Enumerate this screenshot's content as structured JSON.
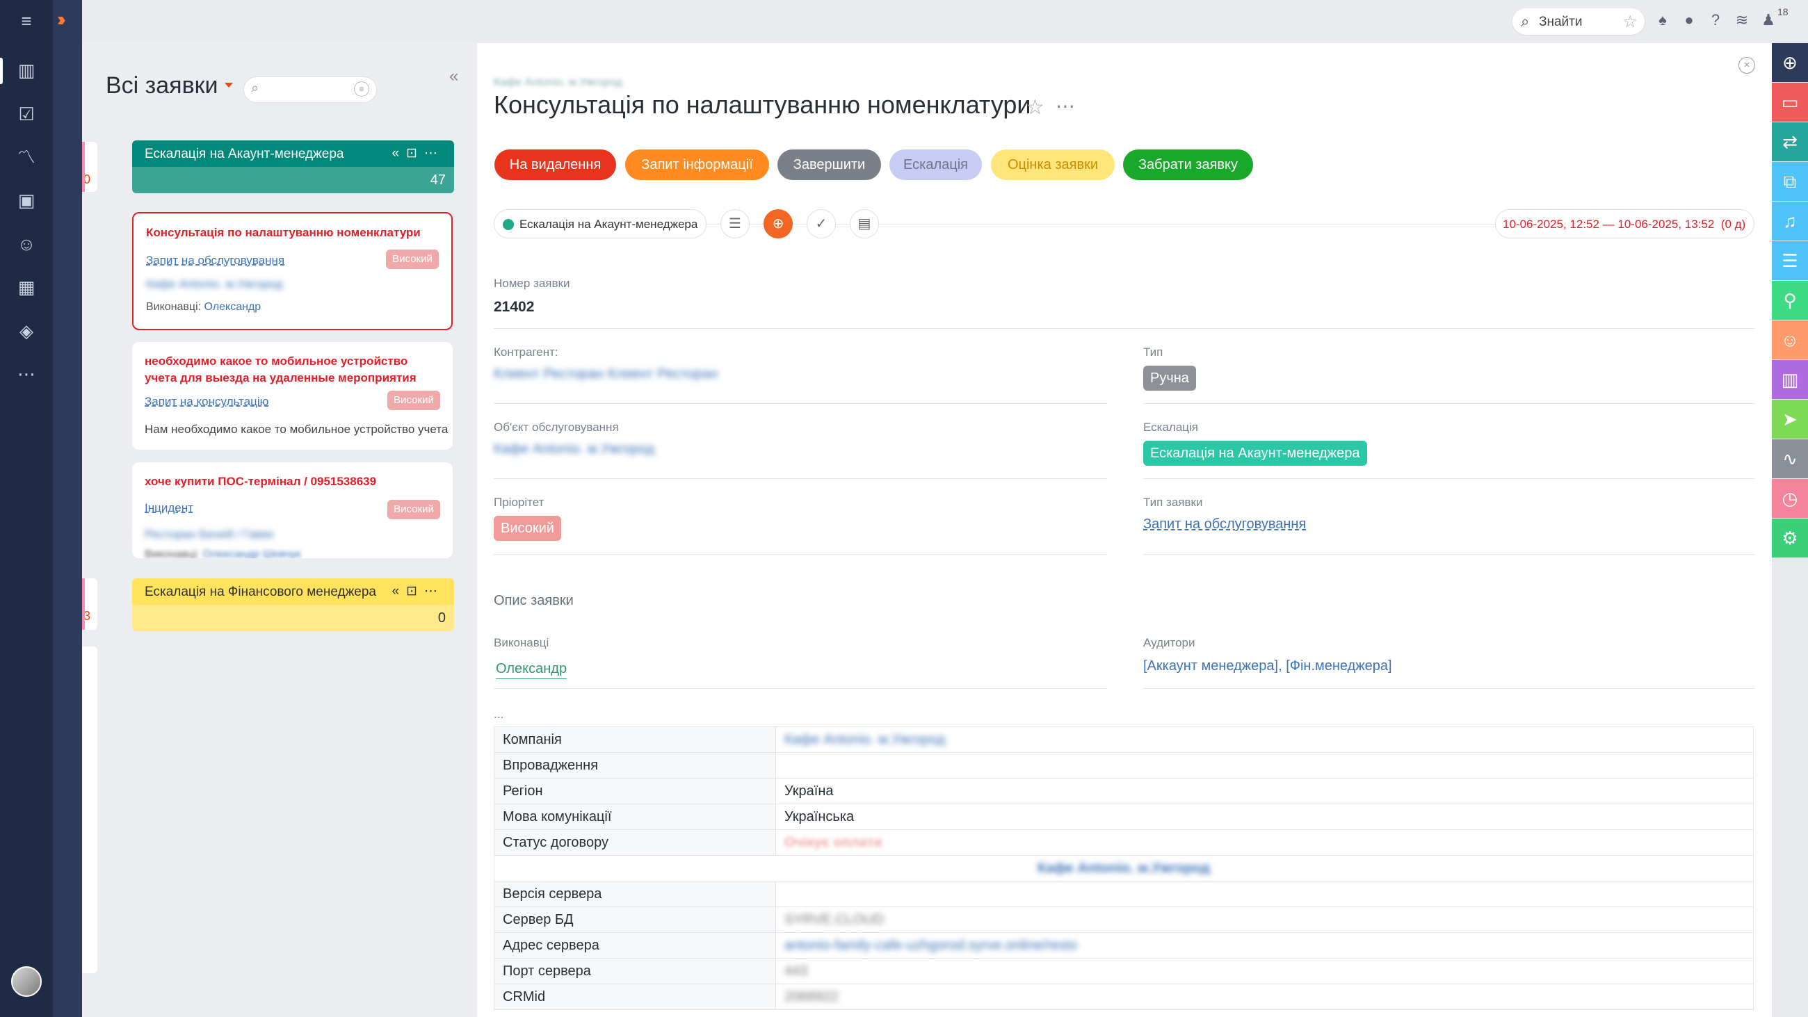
{
  "top": {
    "search_label": "Знайти",
    "notifications_count": "18"
  },
  "kanban": {
    "title": "Всі заявки",
    "left_numbers": [
      "0",
      "3"
    ],
    "columns": [
      {
        "name": "Ескалація на Акаунт-менеджера",
        "count": "47",
        "color": "#00897b"
      },
      {
        "name": "Ескалація на Фінансового менеджера",
        "count": "0",
        "color": "#ffe35c"
      }
    ],
    "cards": [
      {
        "title": "Консультація по налаштуванню номенклатури",
        "type": "Запит на обслуговування",
        "priority": "Високий",
        "client": "Кафе Antonio. м.Ужгород",
        "executors_label": "Виконавці:",
        "executor": "Олександр"
      },
      {
        "title": "необходимо какое то мобильное устройство учета для выезда на удаленные мероприятия",
        "type": "Запит на консультацію",
        "priority": "Високий",
        "description": "Нам необходимо какое то мобильное устройство учета"
      },
      {
        "title": "хоче купити ПОС-термінал / 0951538639",
        "type": "Інцидент",
        "priority": "Високий",
        "client": "Ресторан Беней / Гавке",
        "executors_label": "Виконавці:",
        "executor": "Олександр Шевчук"
      }
    ]
  },
  "detail": {
    "breadcrumb": "Кафе Antonio. м.Ужгород",
    "title": "Консультація по налаштуванню номенклатури",
    "actions": [
      {
        "label": "На видалення",
        "bg": "#e8341c"
      },
      {
        "label": "Запит інформації",
        "bg": "#ff8a1f"
      },
      {
        "label": "Завершити",
        "bg": "#7b7f88"
      },
      {
        "label": "Ескалація",
        "bg": "#c7cdf2"
      },
      {
        "label": "Оцінка заявки",
        "bg": "#ffe57a"
      },
      {
        "label": "Забрати заявку",
        "bg": "#18a82a"
      }
    ],
    "stage": "Ескалація на Акаунт-менеджера",
    "date_range": "10-06-2025, 12:52 — 10-06-2025, 13:52",
    "duration": "(0 д)",
    "fields": {
      "number_label": "Номер заявки",
      "number": "21402",
      "client_label": "Контрагент:",
      "client": "Клиент Ресторан Клиент Ресторан",
      "type_label": "Тип",
      "type": "Ручна",
      "object_label": "Об'єкт обслуговування",
      "object": "Кафе Antonio. м.Ужгород",
      "escalation_label": "Ескалація",
      "escalation": "Ескалація на Акаунт-менеджера",
      "priority_label": "Пріорітет",
      "priority": "Високий",
      "request_type_label": "Тип заявки",
      "request_type": "Запит на обслуговування",
      "description_label": "Опис заявки",
      "executors_label": "Виконавці",
      "executor": "Олександр",
      "auditors_label": "Аудитори",
      "auditor_1": "[Аккаунт менеджера]",
      "auditor_sep": ", ",
      "auditor_2": "[Фін.менеджера]",
      "ellipsis": "..."
    },
    "table": [
      {
        "k": "Компанія",
        "v": "Кафе Antonio. м.Ужгород",
        "style": "bl"
      },
      {
        "k": "Впровадження",
        "v": ""
      },
      {
        "k": "Регіон",
        "v": "Україна"
      },
      {
        "k": "Мова комунікації",
        "v": "Українська"
      },
      {
        "k": "Статус договору",
        "v": "Очікує оплати",
        "style": "st"
      },
      {
        "k": "",
        "v": "Кафе Antonio. м.Ужгород",
        "style": "full"
      },
      {
        "k": "Версія сервера",
        "v": ""
      },
      {
        "k": "Сервер БД",
        "v": "SYRVE.CLOUD",
        "style": "gr"
      },
      {
        "k": "Адрес сервера",
        "v": "antonio-family-cafe-uzhgorod.syrve.online/resto",
        "style": "bl"
      },
      {
        "k": "Порт сервера",
        "v": "443",
        "style": "gr"
      },
      {
        "k": "CRMid",
        "v": "2068922",
        "style": "gr"
      }
    ]
  },
  "rail_colors": [
    "#2e3a5a",
    "#ef5b5b",
    "#26a69a",
    "#4fc3f7",
    "#4fc3f7",
    "#4fc3f7",
    "#3ddc84",
    "#ff9a6a",
    "#b06be0",
    "#7ed957",
    "#8a8f99",
    "#f4849b",
    "#3ccf7a"
  ]
}
